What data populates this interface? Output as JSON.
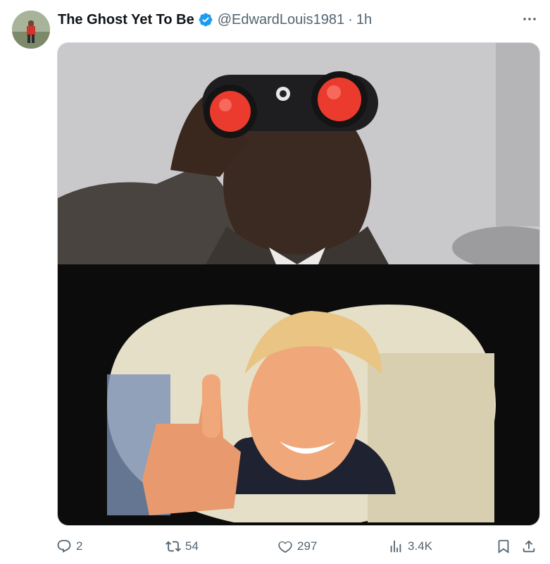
{
  "post": {
    "author": {
      "display_name": "The Ghost Yet To Be",
      "handle": "@EdwardLouis1981",
      "separator": "·",
      "time": "1h",
      "verified_icon": "verified-badge-icon"
    },
    "more_icon": "more-horizontal-icon",
    "media_alt": "meme image",
    "actions": {
      "replies": "2",
      "reposts": "54",
      "likes": "297",
      "views": "3.4K"
    }
  },
  "colors": {
    "accent": "#1d9bf0",
    "secondary_text": "#536471",
    "primary_text": "#0f1419"
  }
}
